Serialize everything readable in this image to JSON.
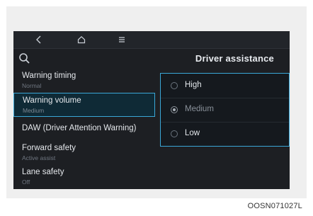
{
  "screen": {
    "title": "Driver assistance",
    "nav_icons": [
      "back-icon",
      "home-icon",
      "menu-icon"
    ],
    "menu_items": [
      {
        "label": "Warning timing",
        "value": "Normal"
      },
      {
        "label": "Warning volume",
        "value": "Medium"
      },
      {
        "label": "DAW (Driver Attention Warning)",
        "value": ""
      },
      {
        "label": "Forward safety",
        "value": "Active assist"
      },
      {
        "label": "Lane safety",
        "value": "Off"
      }
    ],
    "options": [
      {
        "label": "High",
        "checked": false
      },
      {
        "label": "Medium",
        "checked": true
      },
      {
        "label": "Low",
        "checked": false
      }
    ],
    "accent_color": "#3aa7d7"
  },
  "caption": "OOSN071027L"
}
